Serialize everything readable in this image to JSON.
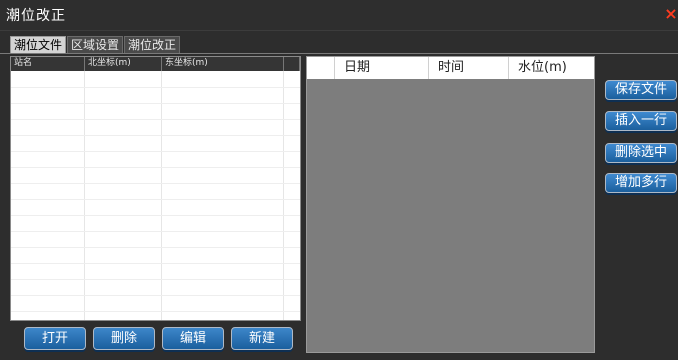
{
  "window": {
    "title": "潮位改正",
    "close_symbol": "×"
  },
  "tabs": [
    {
      "label": "潮位文件",
      "active": true
    },
    {
      "label": "区域设置",
      "active": false
    },
    {
      "label": "潮位改正",
      "active": false
    }
  ],
  "station_table": {
    "columns": [
      "站名",
      "北坐标(m)",
      "东坐标(m)",
      ""
    ],
    "rows": []
  },
  "file_buttons": {
    "open": "打开",
    "delete": "删除",
    "edit": "编辑",
    "new": "新建"
  },
  "tide_table": {
    "columns": [
      "",
      "日期",
      "时间",
      "水位(m)"
    ],
    "rows": []
  },
  "side_buttons": {
    "save": "保存文件",
    "insert": "插入一行",
    "delete_selected": "删除选中",
    "add_rows": "增加多行"
  },
  "colors": {
    "close": "#ff3b1f",
    "button_top": "#3d86c9",
    "button_bottom": "#1a5f9e",
    "table_bg": "#7d7d7d"
  }
}
